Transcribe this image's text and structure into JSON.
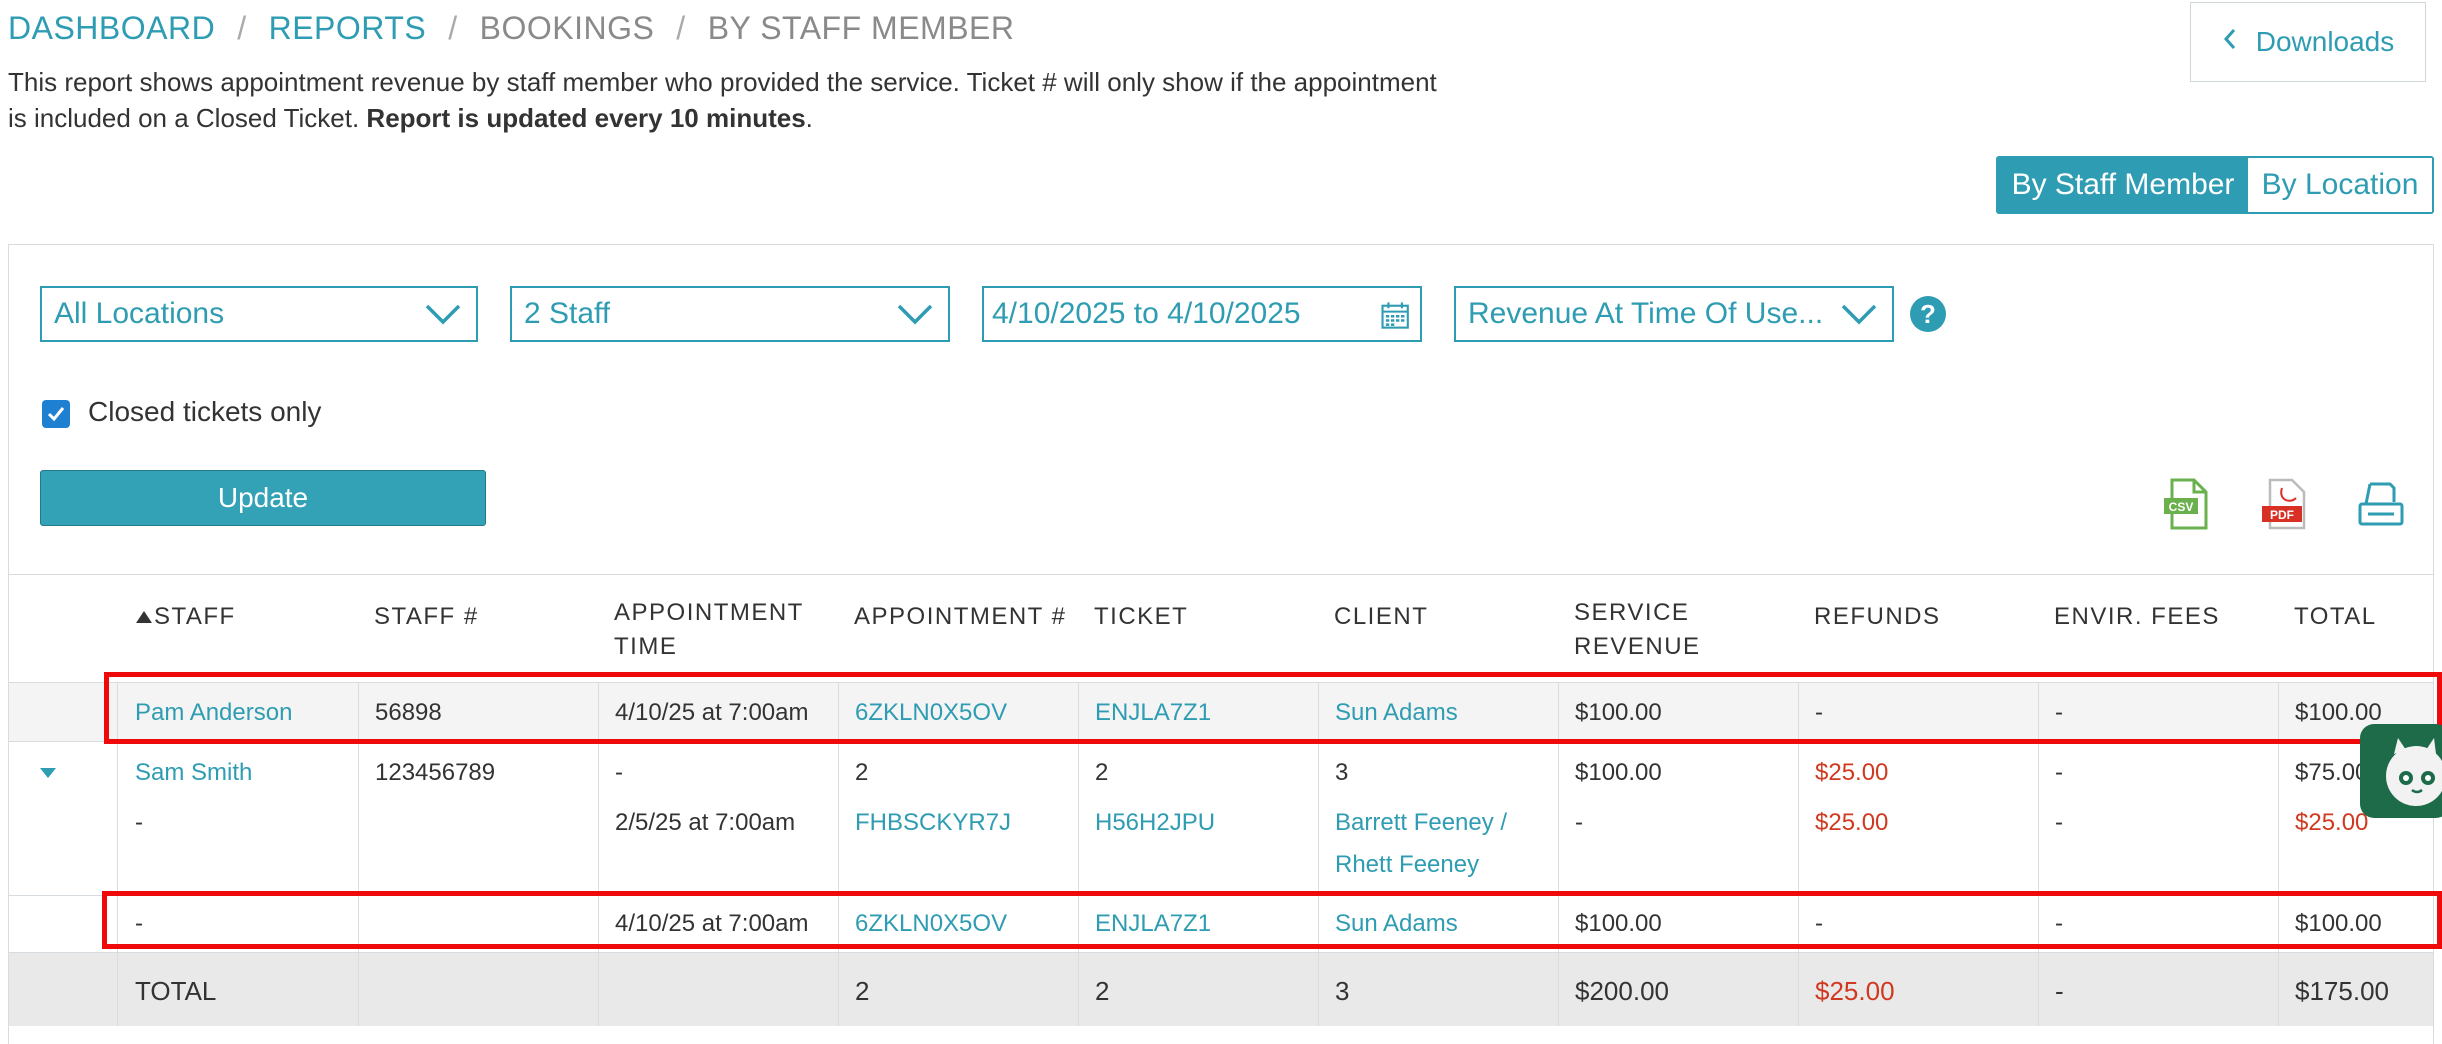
{
  "breadcrumb": [
    "DASHBOARD",
    "REPORTS",
    "BOOKINGS",
    "BY STAFF MEMBER"
  ],
  "description": {
    "line1": "This report shows appointment revenue by staff member who provided the service. Ticket # will only show if the appointment",
    "line2_start": "is included on a Closed Ticket. ",
    "line2_bold": "Report is updated every 10 minutes",
    "line2_end": "."
  },
  "downloads_label": "Downloads",
  "view_toggle": {
    "active": "By Staff Member",
    "inactive": "By Location"
  },
  "filters": {
    "location": "All Locations",
    "staff": "2 Staff",
    "date_range": "4/10/2025 to 4/10/2025",
    "revenue_type": "Revenue At Time Of Use...",
    "help": "?"
  },
  "closed_only": {
    "label": "Closed tickets only",
    "checked": true
  },
  "update_label": "Update",
  "export_icons": {
    "csv": "CSV",
    "pdf": "PDF"
  },
  "table": {
    "headers": {
      "staff": "STAFF",
      "staff_num": "STAFF #",
      "appt_time_1": "APPOINTMENT",
      "appt_time_2": "TIME",
      "appt_num": "APPOINTMENT #",
      "ticket": "TICKET",
      "client": "CLIENT",
      "service_rev_1": "SERVICE",
      "service_rev_2": "REVENUE",
      "refunds": "REFUNDS",
      "envir_fees": "ENVIR. FEES",
      "total": "TOTAL"
    },
    "rows": [
      {
        "staff": "Pam Anderson",
        "staff_num": "56898",
        "time": "4/10/25 at 7:00am",
        "appt": "6ZKLN0X5OV",
        "ticket": "ENJLA7Z1",
        "client": "Sun Adams",
        "service": "$100.00",
        "refunds": "-",
        "envir": "-",
        "total": "$100.00"
      },
      {
        "staff": "Sam Smith",
        "staff_num": "123456789",
        "time": "-",
        "appt": "2",
        "ticket": "2",
        "client": "3",
        "service": "$100.00",
        "refunds": "$25.00",
        "envir": "-",
        "total": "$75.00"
      },
      {
        "staff": "-",
        "staff_num": "",
        "time": "2/5/25 at 7:00am",
        "appt": "FHBSCKYR7J",
        "ticket": "H56H2JPU",
        "client_1": "Barrett Feeney /",
        "client_2": "Rhett Feeney",
        "service": "-",
        "refunds": "$25.00",
        "envir": "-",
        "total": "$25.00"
      },
      {
        "staff": "-",
        "staff_num": "",
        "time": "4/10/25 at 7:00am",
        "appt": "6ZKLN0X5OV",
        "ticket": "ENJLA7Z1",
        "client": "Sun Adams",
        "service": "$100.00",
        "refunds": "-",
        "envir": "-",
        "total": "$100.00"
      }
    ],
    "totals": {
      "label": "TOTAL",
      "appt": "2",
      "ticket": "2",
      "client": "3",
      "service": "$200.00",
      "refunds": "$25.00",
      "envir": "-",
      "total": "$175.00"
    }
  },
  "colors": {
    "accent": "#2e9cb2",
    "refund_red": "#d0391f",
    "highlight": "#ee0a0a",
    "checkbox": "#1f7fd0"
  }
}
